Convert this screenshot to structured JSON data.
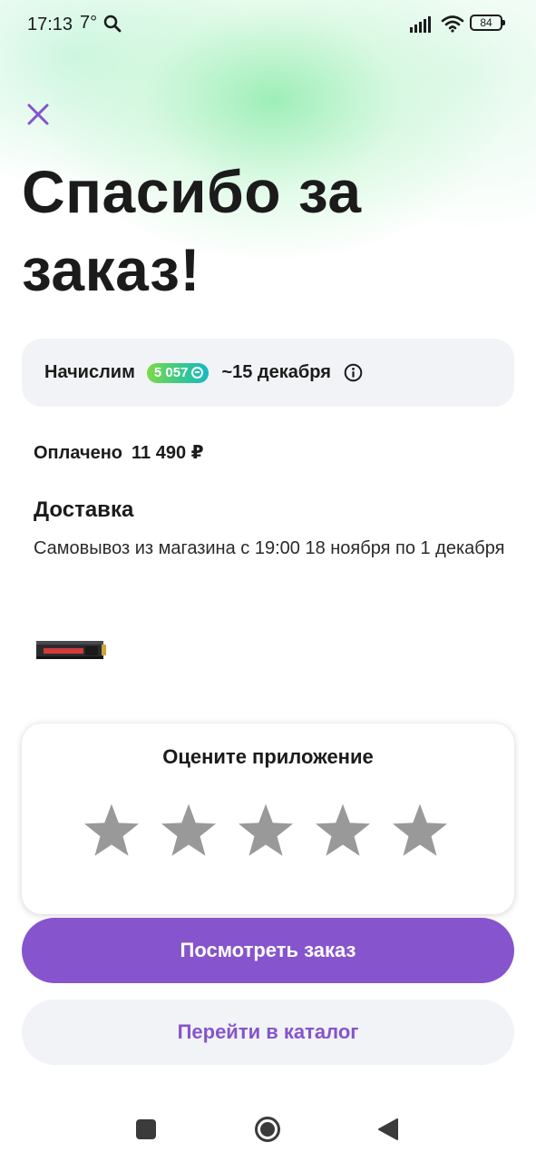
{
  "status_bar": {
    "time": "17:13",
    "temperature": "7°",
    "battery_level": "84",
    "icons": [
      "search-icon",
      "signal-icon",
      "wifi-icon",
      "battery-icon"
    ]
  },
  "header": {
    "title": "Спасибо за заказ!"
  },
  "bonus": {
    "label": "Начислим",
    "amount": "5 057",
    "date": "~15 декабря",
    "badge_gradient": [
      "#7dd94a",
      "#19b7c6"
    ]
  },
  "payment": {
    "label": "Оплачено",
    "amount": "11 490 ₽"
  },
  "delivery": {
    "heading": "Доставка",
    "text": "Самовывоз из магазина с 19:00 18 ноября по 1 декабря"
  },
  "rating": {
    "title": "Оцените приложение",
    "star_count": 5,
    "selected": 0
  },
  "actions": {
    "view_order": "Посмотреть заказ",
    "go_catalog": "Перейти в каталог"
  },
  "colors": {
    "accent": "#8654cc",
    "card_bg": "#f1f3f6",
    "star_inactive": "#999999",
    "text": "#1b1b1b"
  }
}
